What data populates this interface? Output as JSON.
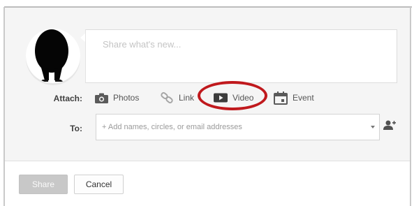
{
  "composer": {
    "share_placeholder": "Share what's new..."
  },
  "attach": {
    "label": "Attach:",
    "items": [
      {
        "label": "Photos",
        "icon": "camera-icon"
      },
      {
        "label": "Link",
        "icon": "link-icon"
      },
      {
        "label": "Video",
        "icon": "video-icon"
      },
      {
        "label": "Event",
        "icon": "calendar-icon"
      }
    ],
    "highlighted": "Video",
    "highlight_color": "#c0191d"
  },
  "recipients": {
    "label": "To:",
    "placeholder": "+ Add names, circles, or email addresses",
    "add_icon": "add-person-icon"
  },
  "actions": {
    "share_label": "Share",
    "cancel_label": "Cancel"
  }
}
